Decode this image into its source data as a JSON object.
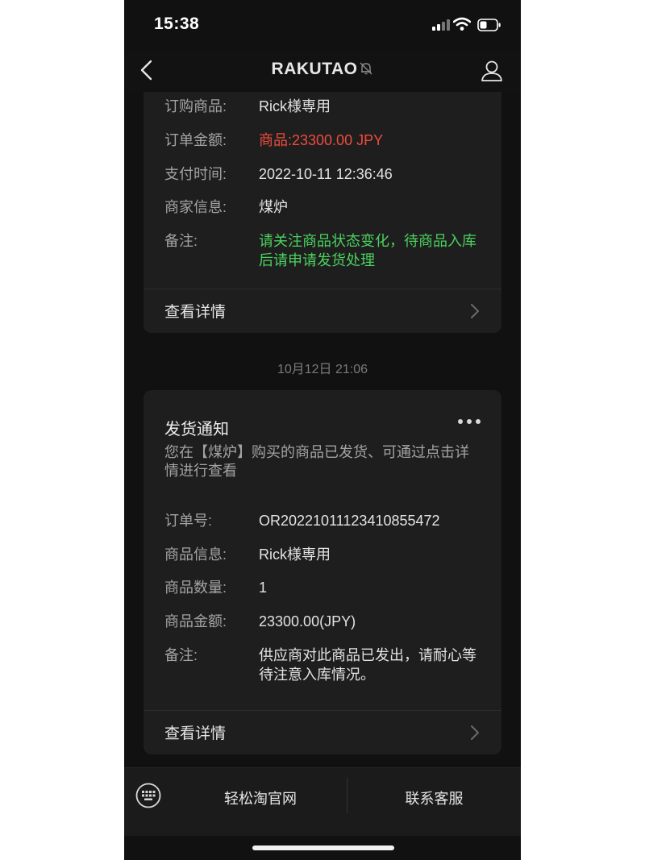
{
  "status_bar": {
    "time": "15:38"
  },
  "nav": {
    "title": "RAKUTAO"
  },
  "order_card": {
    "rows": [
      {
        "label": "订购商品:",
        "value": "Rick様専用"
      },
      {
        "label": "订单金额:",
        "value": "商品:23300.00 JPY",
        "color": "#ef4b3c"
      },
      {
        "label": "支付时间:",
        "value": "2022-10-11 12:36:46"
      },
      {
        "label": "商家信息:",
        "value": "煤炉"
      },
      {
        "label": "备注:",
        "value": "请关注商品状态变化，待商品入库后请申请发货处理",
        "color": "#4bd15f"
      }
    ],
    "detail_label": "查看详情"
  },
  "timestamp": "10月12日 21:06",
  "shipping_card": {
    "title": "发货通知",
    "description": "您在【煤炉】购买的商品已发货、可通过点击详情进行查看",
    "rows": [
      {
        "label": "订单号:",
        "value": "OR20221011123410855472"
      },
      {
        "label": "商品信息:",
        "value": "Rick様専用"
      },
      {
        "label": "商品数量:",
        "value": "1"
      },
      {
        "label": "商品金额:",
        "value": "23300.00(JPY)"
      },
      {
        "label": "备注:",
        "value": "供应商对此商品已发出，请耐心等待注意入库情况。"
      }
    ],
    "detail_label": "查看详情"
  },
  "toolbar": {
    "left_label": "轻松淘官网",
    "right_label": "联系客服"
  }
}
